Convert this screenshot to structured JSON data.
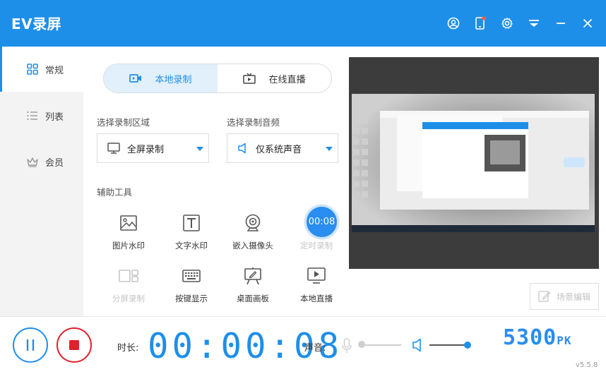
{
  "app": {
    "title": "EV录屏",
    "version": "v5.5.8"
  },
  "titlebar": {
    "icons": [
      "user-icon",
      "phone-icon",
      "gear-icon",
      "menu-icon",
      "minimize-icon",
      "close-icon"
    ]
  },
  "sidebar": {
    "items": [
      {
        "label": "常规",
        "icon": "grid-icon",
        "active": true
      },
      {
        "label": "列表",
        "icon": "list-icon",
        "active": false
      },
      {
        "label": "会员",
        "icon": "crown-icon",
        "active": false
      }
    ]
  },
  "mode_tabs": [
    {
      "label": "本地录制",
      "icon": "record-icon",
      "active": true
    },
    {
      "label": "在线直播",
      "icon": "tv-icon",
      "active": false
    }
  ],
  "region": {
    "label": "选择录制区域",
    "value": "全屏录制"
  },
  "audio": {
    "label": "选择录制音频",
    "value": "仅系统声音"
  },
  "tools": {
    "label": "辅助工具",
    "items": [
      {
        "label": "图片水印",
        "icon": "image-icon",
        "enabled": true
      },
      {
        "label": "文字水印",
        "icon": "text-icon",
        "enabled": true
      },
      {
        "label": "嵌入摄像头",
        "icon": "webcam-icon",
        "enabled": true
      },
      {
        "label": "定时录制",
        "icon": "timer-icon",
        "enabled": true
      },
      {
        "label": "分屏录制",
        "icon": "split-icon",
        "enabled": false
      },
      {
        "label": "按键显示",
        "icon": "keyboard-icon",
        "enabled": true
      },
      {
        "label": "桌面画板",
        "icon": "easel-icon",
        "enabled": true
      },
      {
        "label": "本地直播",
        "icon": "play-screen-icon",
        "enabled": true
      }
    ]
  },
  "timer_badge": "00:08",
  "scene_edit": {
    "label": "场景编辑"
  },
  "bottom": {
    "duration_label": "时长:",
    "duration": "00:00:08",
    "sound_label": "声音:",
    "brand": "5300",
    "brand_suffix": "PK",
    "mic_level": 0.0,
    "system_level": 1.0
  },
  "colors": {
    "accent": "#1e8fe8",
    "stop": "#e0202a"
  }
}
